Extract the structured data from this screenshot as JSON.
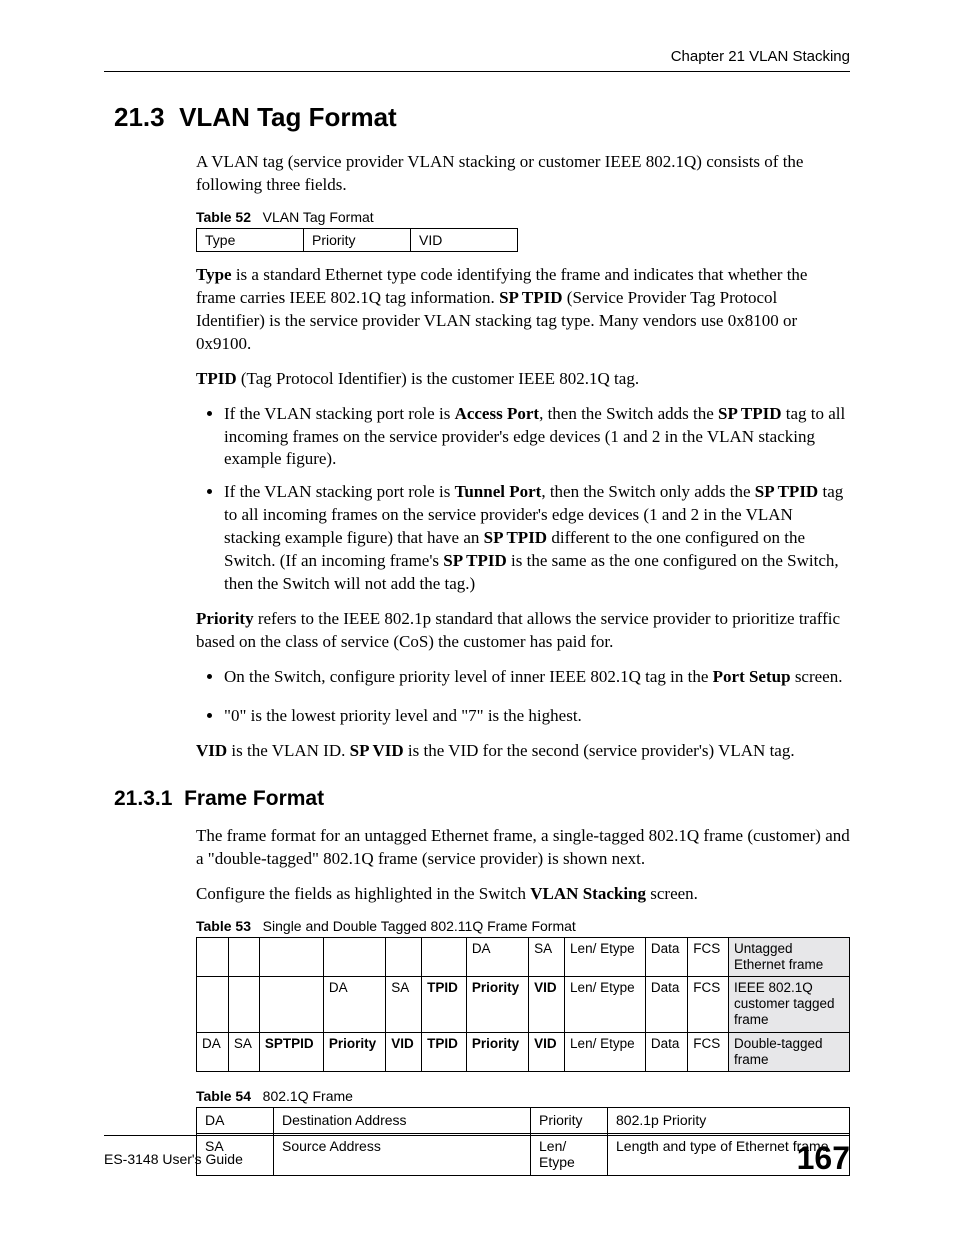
{
  "chapter_header": "Chapter 21 VLAN Stacking",
  "section": {
    "number": "21.3",
    "title": "VLAN Tag Format"
  },
  "intro_para": "A VLAN tag (service provider VLAN stacking or customer IEEE 802.1Q) consists of the following three fields.",
  "table52": {
    "label": "Table 52",
    "title": "VLAN Tag Format",
    "cols": [
      "Type",
      "Priority",
      "VID"
    ]
  },
  "para_type_a": "Type",
  "para_type_b": " is a standard Ethernet type code identifying the frame and indicates that whether the frame carries IEEE 802.1Q tag information. ",
  "para_type_c": "SP TPID",
  "para_type_d": " (Service Provider Tag Protocol Identifier) is the service provider VLAN stacking tag type. Many vendors use 0x8100 or 0x9100.",
  "para_tpid_a": "TPID",
  "para_tpid_b": " (Tag Protocol Identifier) is the customer IEEE 802.1Q tag.",
  "bullets_tpid": {
    "b1_a": "If the VLAN stacking port role is ",
    "b1_b": "Access Port",
    "b1_c": ", then the Switch adds the ",
    "b1_d": "SP TPID",
    "b1_e": " tag to all incoming frames on the service provider's edge devices (1 and 2 in the VLAN stacking example figure).",
    "b2_a": "If the VLAN stacking port role is ",
    "b2_b": "Tunnel Port",
    "b2_c": ", then the Switch only adds the ",
    "b2_d": "SP TPID",
    "b2_e": " tag to all incoming frames on the service provider's edge devices (1 and 2 in the VLAN stacking example figure) that have an ",
    "b2_f": "SP TPID",
    "b2_g": " different to the one configured on the Switch. (If an incoming frame's ",
    "b2_h": "SP TPID",
    "b2_i": " is the same as the one configured on the Switch, then the Switch will not add the tag.)"
  },
  "para_priority_a": "Priority",
  "para_priority_b": " refers to the IEEE 802.1p standard that allows the service provider to prioritize traffic based on the class of service (CoS) the customer has paid for.",
  "bullets_priority": {
    "b1_a": "On the Switch, configure priority level of inner IEEE 802.1Q tag in the ",
    "b1_b": "Port Setup",
    "b1_c": " screen.",
    "b2": "\"0\" is the lowest priority level and \"7\" is the highest."
  },
  "para_vid_a": "VID",
  "para_vid_b": " is the VLAN ID. ",
  "para_vid_c": "SP VID",
  "para_vid_d": " is the VID for the second (service provider's) VLAN tag.",
  "subsection": {
    "number": "21.3.1",
    "title": "Frame Format"
  },
  "sub_para1": "The frame format for an untagged Ethernet frame, a single-tagged 802.1Q frame (customer) and a \"double-tagged\" 802.1Q frame (service provider) is shown next.",
  "sub_para2_a": "Configure the fields as highlighted in the Switch ",
  "sub_para2_b": "VLAN Stacking",
  "sub_para2_c": " screen.",
  "table53": {
    "label": "Table 53",
    "title": "Single and Double Tagged 802.11Q Frame Format",
    "rows": [
      [
        "",
        "",
        "",
        "",
        "",
        "",
        "DA",
        "SA",
        "Len/\nEtype",
        "Data",
        "FCS",
        "Untagged Ethernet frame"
      ],
      [
        "",
        "",
        "",
        "DA",
        "SA",
        "TPID",
        "Priority",
        "VID",
        "Len/\nEtype",
        "Data",
        "FCS",
        "IEEE 802.1Q customer tagged frame"
      ],
      [
        "DA",
        "SA",
        "SPTPID",
        "Priority",
        "VID",
        "TPID",
        "Priority",
        "VID",
        "Len/\nEtype",
        "Data",
        "FCS",
        "Double-tagged frame"
      ]
    ]
  },
  "table54": {
    "label": "Table 54",
    "title": "802.1Q Frame",
    "rows": [
      [
        "DA",
        "Destination Address",
        "Priority",
        "802.1p Priority"
      ],
      [
        "SA",
        "Source Address",
        "Len/\nEtype",
        "Length and type of Ethernet frame"
      ]
    ]
  },
  "footer": {
    "left": "ES-3148 User's Guide",
    "right": "167"
  }
}
